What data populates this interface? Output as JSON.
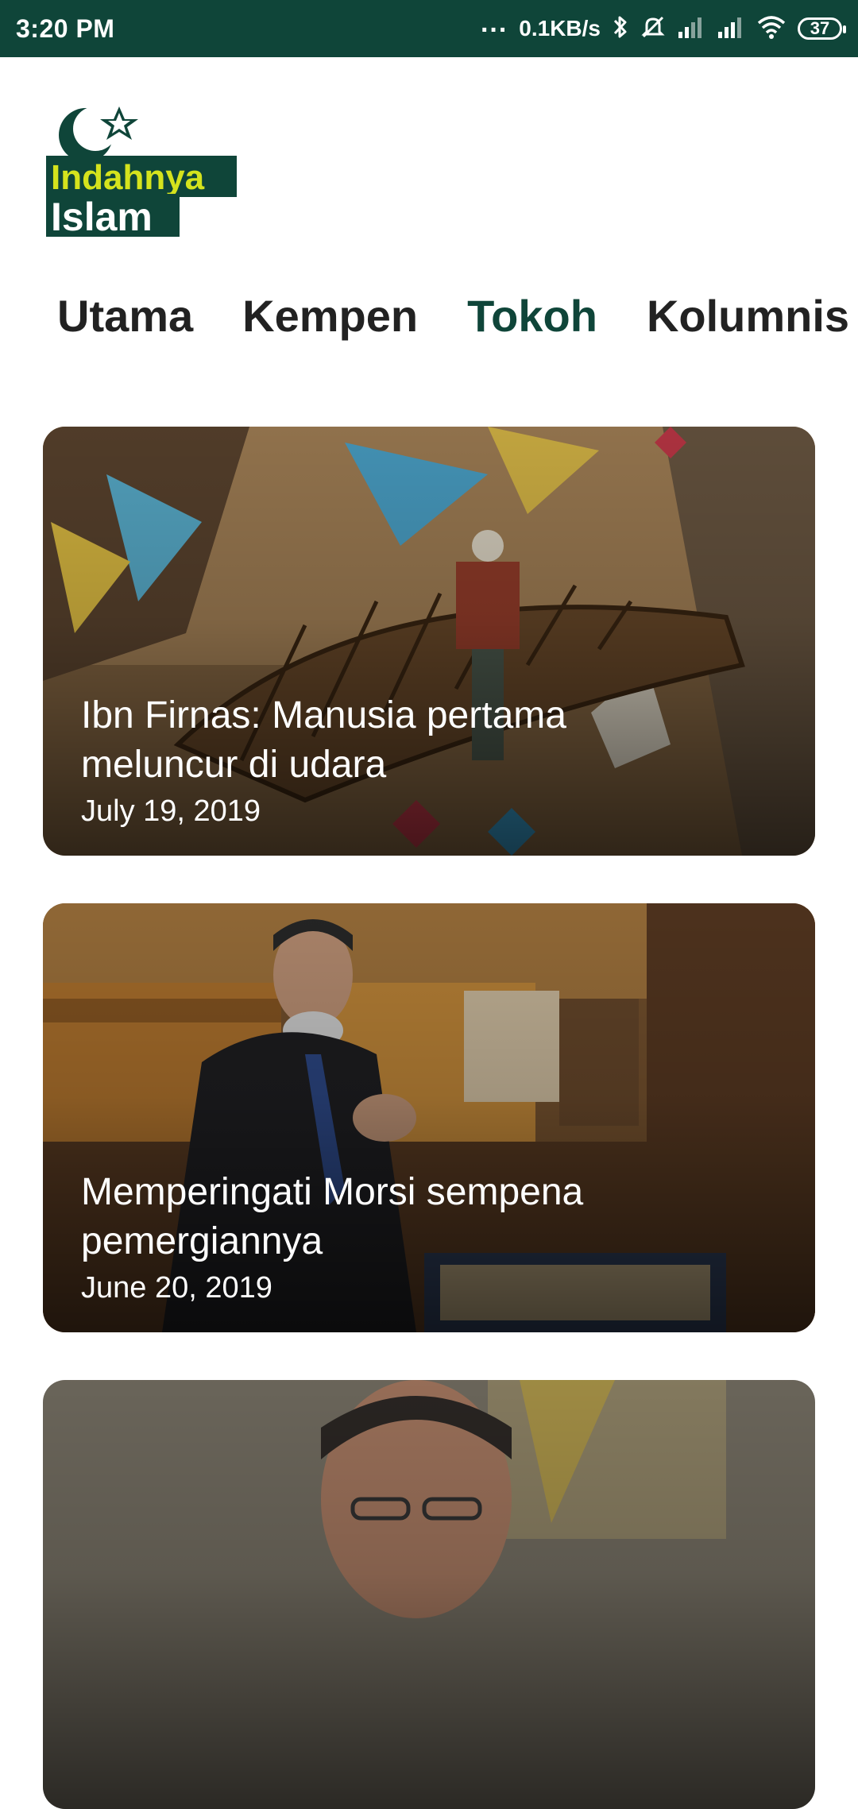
{
  "status_bar": {
    "time": "3:20 PM",
    "dots": "...",
    "speed": "0.1KB/s",
    "battery": "37",
    "icons": [
      "bluetooth-icon",
      "mute-icon",
      "signal-icon",
      "signal-icon",
      "wifi-icon",
      "battery-icon"
    ]
  },
  "logo": {
    "line1": "Indahnya",
    "line2": "Islam",
    "icon": "crescent-star-icon",
    "colors": {
      "dark": "#0f4539",
      "accent": "#d5e31d"
    }
  },
  "tabs": [
    {
      "label": "Utama",
      "active": false
    },
    {
      "label": "Kempen",
      "active": false
    },
    {
      "label": "Tokoh",
      "active": true
    },
    {
      "label": "Kolumnis",
      "active": false
    }
  ],
  "articles": [
    {
      "title": "Ibn Firnas: Manusia pertama meluncur di udara",
      "date": "July 19, 2019"
    },
    {
      "title": "Memperingati Morsi sempena pemergiannya",
      "date": "June 20, 2019"
    },
    {
      "title": "",
      "date": ""
    }
  ],
  "colors": {
    "brand": "#0f4539",
    "text": "#222222",
    "card_text": "#ffffff"
  }
}
